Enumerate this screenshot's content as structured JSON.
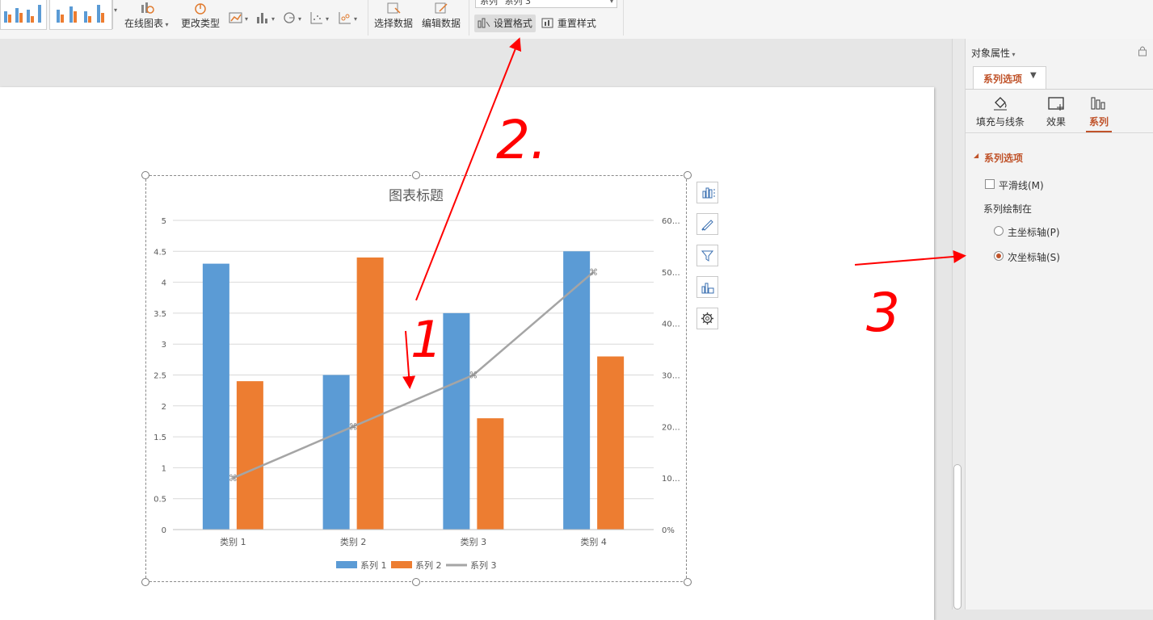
{
  "ribbon": {
    "online_chart": "在线图表",
    "change_type": "更改类型",
    "select_data": "选择数据",
    "edit_data": "编辑数据",
    "series_selector": "系列 \"系列 3\"",
    "set_format": "设置格式",
    "reset_style": "重置样式"
  },
  "side_buttons": [
    "chart-elements-icon",
    "chart-style-icon",
    "chart-filter-icon",
    "quick-layout-icon",
    "chart-settings-icon"
  ],
  "panel": {
    "title": "对象属性",
    "tab_series_options": "系列选项",
    "subtab_fill": "填充与线条",
    "subtab_effect": "效果",
    "subtab_series": "系列",
    "section_title": "系列选项",
    "smooth_line": "平滑线(M)",
    "plot_on": "系列绘制在",
    "primary_axis": "主坐标轴(P)",
    "secondary_axis": "次坐标轴(S)",
    "selected_axis": "secondary",
    "accent_color": "#c0532a"
  },
  "annotations": {
    "mark_1": "1",
    "mark_2": "2.",
    "mark_3": "3",
    "color": "#ff0000"
  },
  "chart_data": {
    "type": "bar",
    "title": "图表标题",
    "categories": [
      "类别 1",
      "类别 2",
      "类别 3",
      "类别 4"
    ],
    "series": [
      {
        "name": "系列 1",
        "type": "bar",
        "axis": "primary",
        "color": "#5b9bd5",
        "values": [
          4.3,
          2.5,
          3.5,
          4.5
        ]
      },
      {
        "name": "系列 2",
        "type": "bar",
        "axis": "primary",
        "color": "#ed7d31",
        "values": [
          2.4,
          4.4,
          1.8,
          2.8
        ]
      },
      {
        "name": "系列 3",
        "type": "line",
        "axis": "secondary",
        "color": "#a5a5a5",
        "values": [
          10,
          20,
          30,
          50
        ]
      }
    ],
    "ylim": [
      0,
      5
    ],
    "y_ticks": [
      "0",
      "0.5",
      "1",
      "1.5",
      "2",
      "2.5",
      "3",
      "3.5",
      "4",
      "4.5",
      "5"
    ],
    "y2lim": [
      0,
      60
    ],
    "y2_ticks": [
      "0%",
      "10…",
      "20…",
      "30…",
      "40…",
      "50…",
      "60…"
    ],
    "grid": true,
    "legend": "bottom"
  }
}
